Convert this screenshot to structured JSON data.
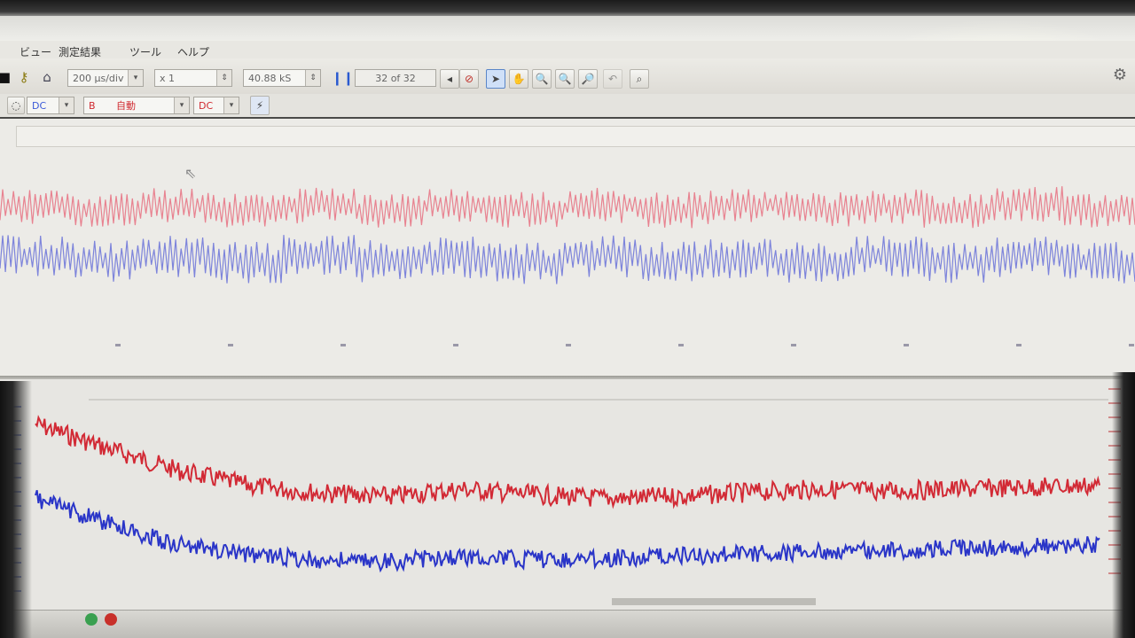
{
  "menu": {
    "items": [
      "ビュー",
      "測定結果",
      "ツール",
      "ヘルプ"
    ]
  },
  "toolbar": {
    "time_div": "200 μs/div",
    "zoom": "x 1",
    "sample_rate": "40.88 kS",
    "frame_counter": "32 of 32"
  },
  "channel_bar": {
    "ch_a_coupling": "DC",
    "ch_b_label": "B",
    "ch_b_mode": "自動",
    "ch_b_coupling": "DC"
  },
  "colors": {
    "trace_red": "#d22a35",
    "trace_blue": "#2a35c8",
    "trace_pink": "#e87080",
    "trace_lightblue": "#6a72d8",
    "background": "#ecebe7"
  },
  "icons": {
    "toolbar": [
      "key-icon",
      "home-icon",
      "stop-icon",
      "arrow-pointer-icon",
      "hand-pan-icon",
      "zoom-in-icon",
      "zoom-area-icon",
      "zoom-out-icon",
      "zoom-fit-icon",
      "settings-icon"
    ]
  },
  "chart_data": [
    {
      "type": "line",
      "description_panel": "upper",
      "series": [
        {
          "values": [
            0.62,
            0.38,
            0.71,
            0.44,
            0.66,
            0.35,
            0.74,
            0.41,
            0.69,
            0.39,
            0.72,
            0.45,
            0.63,
            0.37,
            0.75,
            0.42
          ]
        },
        {
          "values": [
            -0.28,
            -0.58,
            -0.31,
            -0.66,
            -0.25,
            -0.61,
            -0.33,
            -0.72,
            -0.29,
            -0.64,
            -0.36,
            -0.69,
            -0.27,
            -0.62,
            -0.3,
            -0.67
          ]
        }
      ]
    },
    {
      "type": "line",
      "description_panel": "lower",
      "series": [
        {
          "values": [
            0.95,
            0.82,
            0.7,
            0.62,
            0.58,
            0.56,
            0.6,
            0.57,
            0.55,
            0.56,
            0.58,
            0.6,
            0.59,
            0.6,
            0.61,
            0.62
          ]
        },
        {
          "values": [
            0.55,
            0.42,
            0.3,
            0.25,
            0.22,
            0.21,
            0.24,
            0.22,
            0.23,
            0.24,
            0.25,
            0.26,
            0.27,
            0.28,
            0.29,
            0.3
          ]
        }
      ]
    }
  ]
}
